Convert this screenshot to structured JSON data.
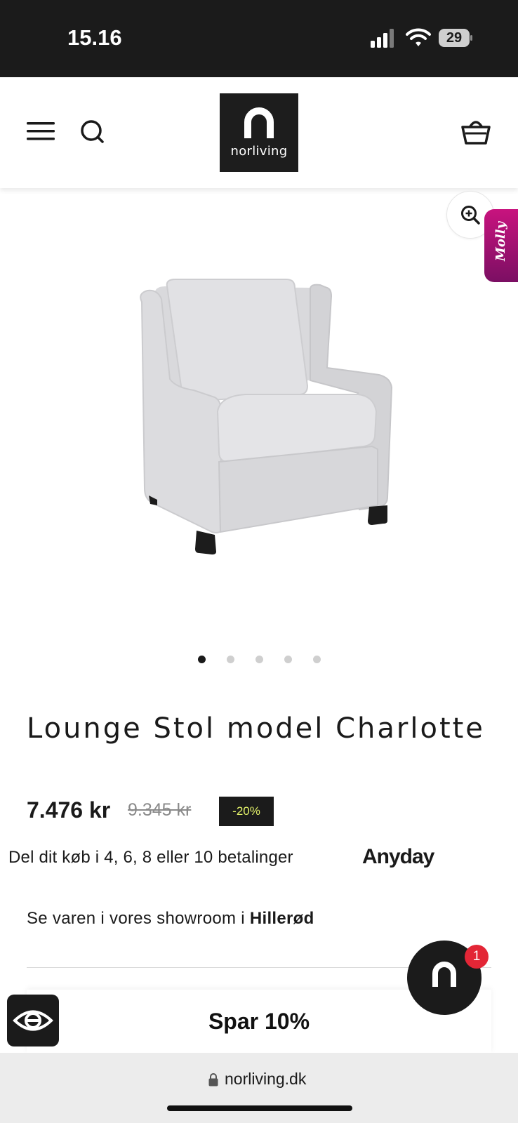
{
  "status_bar": {
    "time": "15.16",
    "battery": "29"
  },
  "header": {
    "logo_text": "norliving"
  },
  "side_tab": {
    "label": "Molly"
  },
  "gallery": {
    "image_count": 5,
    "active_index": 0
  },
  "product": {
    "title": "Lounge Stol model Charlotte",
    "price": "7.476 kr",
    "old_price": "9.345 kr",
    "discount": "-20%",
    "installments_text": "Del dit køb i 4, 6, 8 eller 10 betalinger",
    "installments_provider": "Anyday",
    "showroom_prefix": "Se varen i vores showroom i ",
    "showroom_location": "Hillerød"
  },
  "chat": {
    "badge_count": "1"
  },
  "promo": {
    "label": "Spar 10%"
  },
  "browser": {
    "url": "norliving.dk"
  },
  "colors": {
    "dark": "#1b1b1b",
    "discount_text": "#e4f36a",
    "molly_start": "#c8137e",
    "molly_end": "#7b0f63",
    "badge": "#e32636"
  }
}
